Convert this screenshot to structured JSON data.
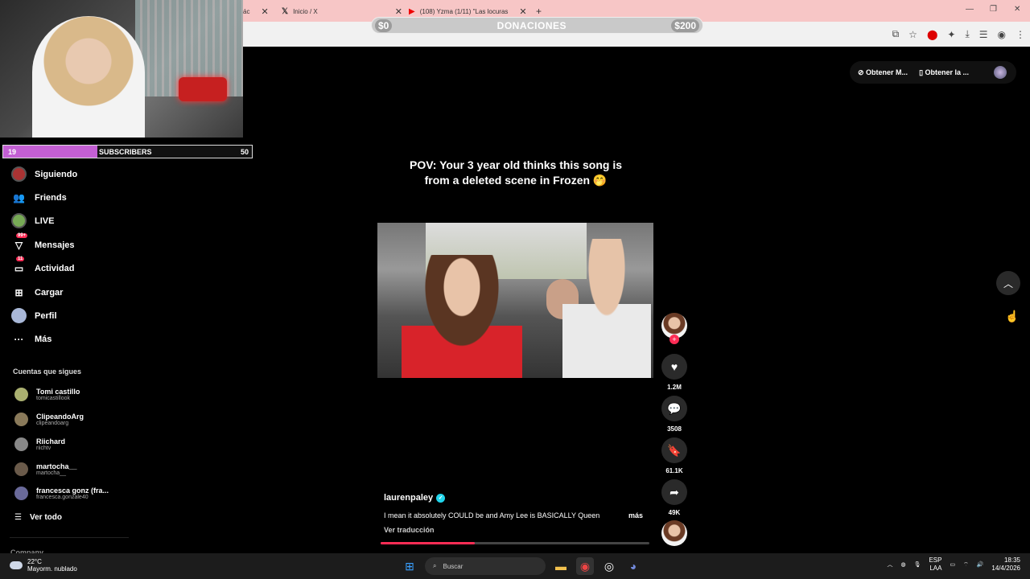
{
  "browser": {
    "tabs": [
      {
        "label": "ác",
        "icon": "tab-icon"
      },
      {
        "label": "Inicio / X",
        "icon": "x-logo-icon"
      },
      {
        "label": "(108) Yzma (1/11) \"Las locuras",
        "icon": "youtube-icon"
      }
    ],
    "new_tab": "+"
  },
  "donation": {
    "left": "$0",
    "label": "DONACIONES",
    "right": "$200"
  },
  "subscribers": {
    "current": "19",
    "label": "SUBSCRIBERS",
    "goal": "50",
    "progress": 0.38
  },
  "sidebar": {
    "items": [
      {
        "label": "Siguiendo",
        "icon": "following-icon"
      },
      {
        "label": "Friends",
        "icon": "friends-icon"
      },
      {
        "label": "LIVE",
        "icon": "live-icon"
      },
      {
        "label": "Mensajes",
        "icon": "messages-icon",
        "badge": "99+"
      },
      {
        "label": "Actividad",
        "icon": "activity-icon",
        "badge": "11"
      },
      {
        "label": "Cargar",
        "icon": "upload-icon"
      },
      {
        "label": "Perfil",
        "icon": "profile-icon"
      },
      {
        "label": "Más",
        "icon": "more-icon"
      }
    ],
    "following_title": "Cuentas que sigues",
    "following": [
      {
        "name": "Tomi castillo",
        "handle": "tomicastillook"
      },
      {
        "name": "ClipeandoArg",
        "handle": "clipeandoarg"
      },
      {
        "name": "Riichard",
        "handle": "riichtv"
      },
      {
        "name": "martocha__",
        "handle": "martocha__"
      },
      {
        "name": "francesca gonz (fra...",
        "handle": "francesca.gonzale40"
      }
    ],
    "see_all": "Ver todo",
    "company": "Company"
  },
  "video": {
    "caption_line1": "POV: Your 3 year old thinks this song is",
    "caption_line2": "from a deleted scene in Frozen 🤭",
    "author": "laurenpaley",
    "description": "I mean it absolutely COULD be and Amy Lee is BASICALLY Queen",
    "more": "más",
    "translate": "Ver traducción",
    "progress": 0.35,
    "likes": "1.2M",
    "comments": "3508",
    "saves": "61.1K",
    "shares": "49K"
  },
  "topbar": {
    "get_coins": "Obtener M...",
    "get_app": "Obtener la ..."
  },
  "taskbar": {
    "temp": "22°C",
    "weather": "Mayorm. nublado",
    "search": "Buscar",
    "lang1": "ESP",
    "lang2": "LAA",
    "time": "18:35",
    "date": "14/4/2026"
  }
}
